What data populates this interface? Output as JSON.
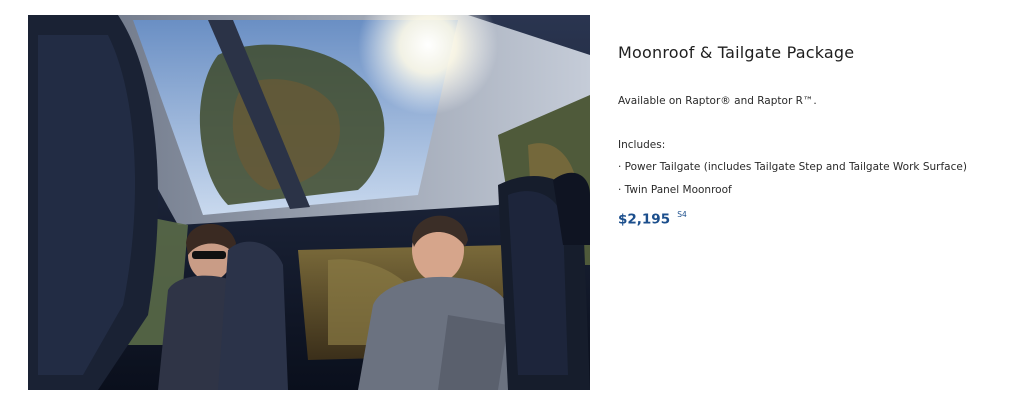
{
  "feature": {
    "title": "Moonroof & Tailgate Package",
    "availability": "Available on Raptor® and Raptor R™.",
    "includes_label": "Includes:",
    "includes": [
      "· Power Tailgate (includes Tailgate Step and Tailgate Work Surface)",
      "· Twin Panel Moonroof"
    ],
    "price": "$2,195",
    "footnote": "S4"
  },
  "colors": {
    "price": "#1b4e8c",
    "text": "#2a2a2a"
  }
}
